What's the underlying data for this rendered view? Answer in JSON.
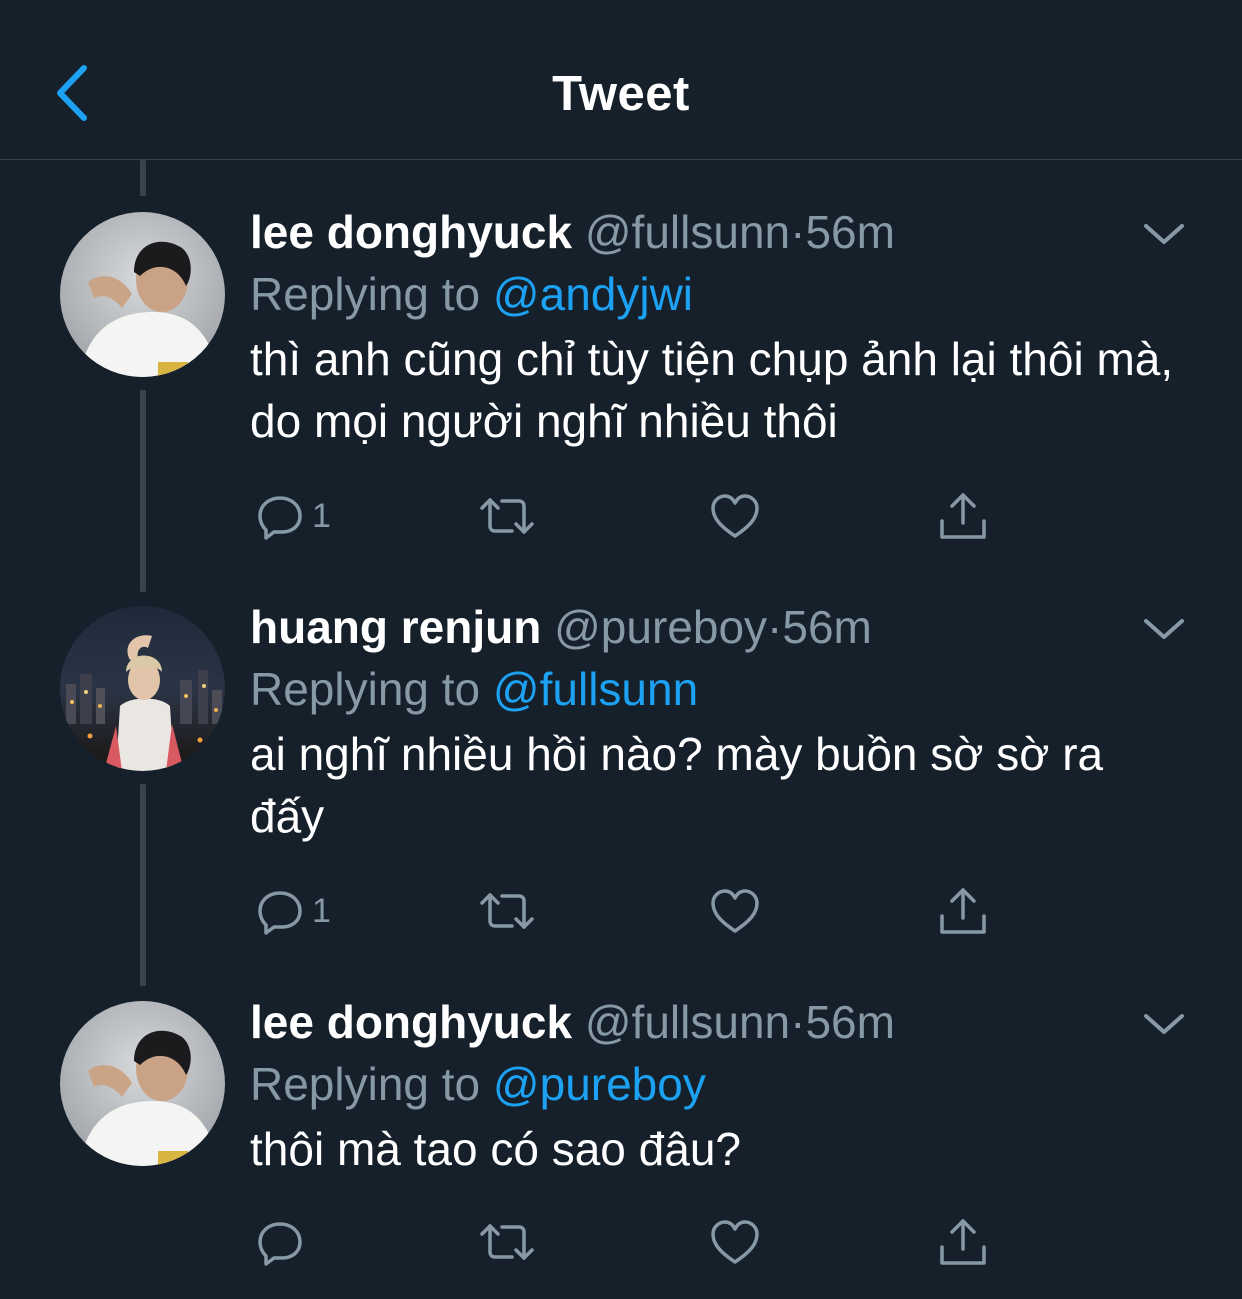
{
  "header": {
    "title": "Tweet",
    "back_icon": "chevron-left-icon",
    "accent_color": "#1da1f2"
  },
  "tweets": [
    {
      "name": "lee donghyuck",
      "handle": "@fullsunn",
      "separator": "·",
      "time": "56m",
      "replying_prefix": "Replying to",
      "replying_to": "@andyjwi",
      "text": "thì anh cũng chỉ tùy tiện chụp ảnh lại thôi mà, do mọi người nghĩ nhiều thôi",
      "reply_count": "1"
    },
    {
      "name": "huang renjun",
      "handle": "@pureboy",
      "separator": "·",
      "time": "56m",
      "replying_prefix": "Replying to",
      "replying_to": "@fullsunn",
      "text": "ai nghĩ nhiều hồi nào? mày buồn sờ sờ ra đấy",
      "reply_count": "1"
    },
    {
      "name": "lee donghyuck",
      "handle": "@fullsunn",
      "separator": "·",
      "time": "56m",
      "replying_prefix": "Replying to",
      "replying_to": "@pureboy",
      "text": "thôi mà tao có sao đâu?",
      "reply_count": ""
    }
  ],
  "icons": {
    "reply": "reply-icon",
    "retweet": "retweet-icon",
    "like": "heart-icon",
    "share": "share-icon",
    "more": "chevron-down-icon"
  },
  "colors": {
    "background": "#15202b",
    "secondary_text": "#8899a6",
    "divider": "#38444d",
    "link": "#1da1f2"
  }
}
